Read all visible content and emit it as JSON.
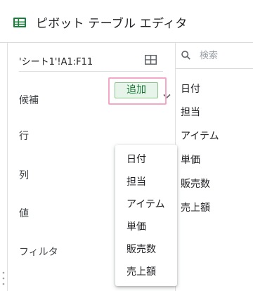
{
  "header": {
    "title": "ピボット テーブル エディタ",
    "icon": "sheets-icon",
    "icon_color": "#188038"
  },
  "editor": {
    "range": "'シート1'!A1:F11",
    "sections": {
      "suggestions": "候補",
      "rows": "行",
      "columns": "列",
      "values": "値",
      "filters": "フィルタ"
    },
    "add_button": "追加",
    "add_button_color": "#137333",
    "highlight_color": "#f4a8c7"
  },
  "dropdown": {
    "items": [
      "日付",
      "担当",
      "アイテム",
      "単価",
      "販売数",
      "売上額"
    ]
  },
  "fields": {
    "search_placeholder": "検索",
    "items": [
      "日付",
      "担当",
      "アイテム",
      "単価",
      "販売数",
      "売上額"
    ]
  }
}
